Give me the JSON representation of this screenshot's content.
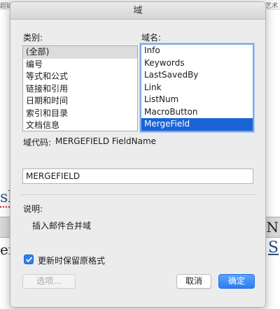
{
  "background": {
    "ribbon_left": "超链",
    "ribbon_right": "艺术",
    "fragment_sl": "sl",
    "fragment_er": "er",
    "fragment_n": "N",
    "fragment_s": "S"
  },
  "dialog": {
    "title": "域",
    "categories": {
      "label": "类别:",
      "items": [
        "(全部)",
        "编号",
        "等式和公式",
        "链接和引用",
        "日期和时间",
        "索引和目录",
        "文档信息"
      ],
      "selected_index": 0
    },
    "field_names": {
      "label": "域名:",
      "items": [
        "Info",
        "Keywords",
        "LastSavedBy",
        "Link",
        "ListNum",
        "MacroButton",
        "MergeField"
      ],
      "selected_index": 6
    },
    "field_code": {
      "label": "域代码:",
      "value": "MERGEFIELD FieldName"
    },
    "field_input": {
      "value": "MERGEFIELD"
    },
    "description": {
      "label": "说明:",
      "text": "插入邮件合并域"
    },
    "preserve_formatting": {
      "label": "更新时保留原格式",
      "checked": true
    },
    "buttons": {
      "options": "选项...",
      "cancel": "取消",
      "ok": "确定"
    }
  }
}
